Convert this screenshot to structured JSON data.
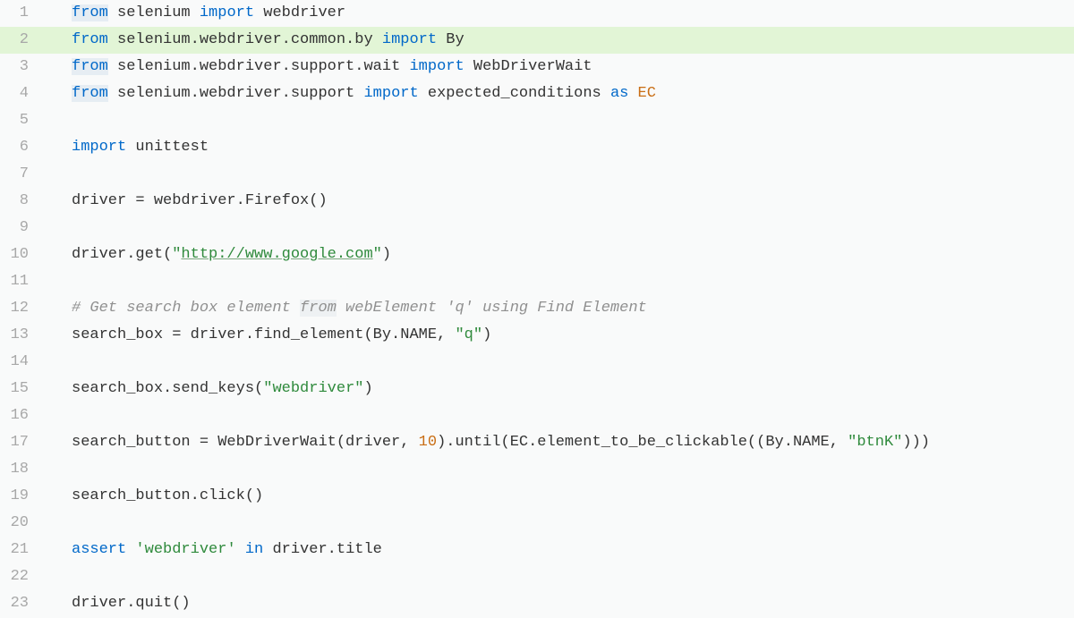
{
  "lines": [
    {
      "num": "1",
      "highlighted": false,
      "tokens": [
        {
          "cls": "tok-kw-sel",
          "text": "from"
        },
        {
          "cls": "tok-plain",
          "text": " selenium "
        },
        {
          "cls": "tok-kw",
          "text": "import"
        },
        {
          "cls": "tok-plain",
          "text": " webdriver"
        }
      ]
    },
    {
      "num": "2",
      "highlighted": true,
      "tokens": [
        {
          "cls": "tok-kw",
          "text": "from"
        },
        {
          "cls": "tok-plain",
          "text": " selenium.webdriver.common.by "
        },
        {
          "cls": "tok-kw",
          "text": "import"
        },
        {
          "cls": "tok-plain",
          "text": " By"
        }
      ]
    },
    {
      "num": "3",
      "highlighted": false,
      "tokens": [
        {
          "cls": "tok-kw-sel",
          "text": "from"
        },
        {
          "cls": "tok-plain",
          "text": " selenium.webdriver.support.wait "
        },
        {
          "cls": "tok-kw",
          "text": "import"
        },
        {
          "cls": "tok-plain",
          "text": " WebDriverWait"
        }
      ]
    },
    {
      "num": "4",
      "highlighted": false,
      "tokens": [
        {
          "cls": "tok-kw-sel",
          "text": "from"
        },
        {
          "cls": "tok-plain",
          "text": " selenium.webdriver.support "
        },
        {
          "cls": "tok-kw",
          "text": "import"
        },
        {
          "cls": "tok-plain",
          "text": " expected_conditions "
        },
        {
          "cls": "tok-kw",
          "text": "as"
        },
        {
          "cls": "tok-plain",
          "text": " "
        },
        {
          "cls": "tok-ident",
          "text": "EC"
        }
      ]
    },
    {
      "num": "5",
      "highlighted": false,
      "tokens": []
    },
    {
      "num": "6",
      "highlighted": false,
      "tokens": [
        {
          "cls": "tok-kw",
          "text": "import"
        },
        {
          "cls": "tok-plain",
          "text": " unittest"
        }
      ]
    },
    {
      "num": "7",
      "highlighted": false,
      "tokens": []
    },
    {
      "num": "8",
      "highlighted": false,
      "tokens": [
        {
          "cls": "tok-plain",
          "text": "driver = webdriver.Firefox()"
        }
      ]
    },
    {
      "num": "9",
      "highlighted": false,
      "tokens": []
    },
    {
      "num": "10",
      "highlighted": false,
      "tokens": [
        {
          "cls": "tok-plain",
          "text": "driver.get("
        },
        {
          "cls": "tok-str",
          "text": "\""
        },
        {
          "cls": "tok-url",
          "text": "http://www.google.com"
        },
        {
          "cls": "tok-str",
          "text": "\""
        },
        {
          "cls": "tok-plain",
          "text": ")"
        }
      ]
    },
    {
      "num": "11",
      "highlighted": false,
      "tokens": []
    },
    {
      "num": "12",
      "highlighted": false,
      "tokens": [
        {
          "cls": "tok-comment",
          "text": "# Get search box element "
        },
        {
          "cls": "tok-comment-sel",
          "text": "from"
        },
        {
          "cls": "tok-comment",
          "text": " webElement 'q' using Find Element"
        }
      ]
    },
    {
      "num": "13",
      "highlighted": false,
      "tokens": [
        {
          "cls": "tok-plain",
          "text": "search_box = driver.find_element(By.NAME, "
        },
        {
          "cls": "tok-str",
          "text": "\"q\""
        },
        {
          "cls": "tok-plain",
          "text": ")"
        }
      ]
    },
    {
      "num": "14",
      "highlighted": false,
      "tokens": []
    },
    {
      "num": "15",
      "highlighted": false,
      "tokens": [
        {
          "cls": "tok-plain",
          "text": "search_box.send_keys("
        },
        {
          "cls": "tok-str",
          "text": "\"webdriver\""
        },
        {
          "cls": "tok-plain",
          "text": ")"
        }
      ]
    },
    {
      "num": "16",
      "highlighted": false,
      "tokens": []
    },
    {
      "num": "17",
      "highlighted": false,
      "tokens": [
        {
          "cls": "tok-plain",
          "text": "search_button = WebDriverWait(driver, "
        },
        {
          "cls": "tok-num",
          "text": "10"
        },
        {
          "cls": "tok-plain",
          "text": ").until(EC.element_to_be_clickable((By.NAME, "
        },
        {
          "cls": "tok-str",
          "text": "\"btnK\""
        },
        {
          "cls": "tok-plain",
          "text": ")))"
        }
      ]
    },
    {
      "num": "18",
      "highlighted": false,
      "tokens": []
    },
    {
      "num": "19",
      "highlighted": false,
      "tokens": [
        {
          "cls": "tok-plain",
          "text": "search_button.click()"
        }
      ]
    },
    {
      "num": "20",
      "highlighted": false,
      "tokens": []
    },
    {
      "num": "21",
      "highlighted": false,
      "tokens": [
        {
          "cls": "tok-kw",
          "text": "assert"
        },
        {
          "cls": "tok-plain",
          "text": " "
        },
        {
          "cls": "tok-str",
          "text": "'webdriver'"
        },
        {
          "cls": "tok-plain",
          "text": " "
        },
        {
          "cls": "tok-kw",
          "text": "in"
        },
        {
          "cls": "tok-plain",
          "text": " driver.title"
        }
      ]
    },
    {
      "num": "22",
      "highlighted": false,
      "tokens": []
    },
    {
      "num": "23",
      "highlighted": false,
      "tokens": [
        {
          "cls": "tok-plain",
          "text": "driver.quit()"
        }
      ]
    }
  ]
}
